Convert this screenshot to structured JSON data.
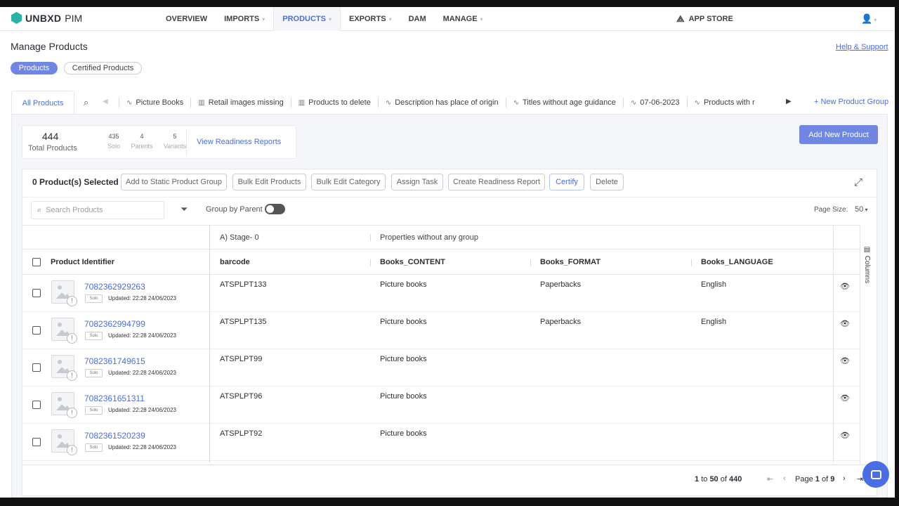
{
  "brand": {
    "name": "UNBXD",
    "product": "PIM"
  },
  "nav": {
    "items": [
      {
        "label": "OVERVIEW",
        "caret": false,
        "active": false
      },
      {
        "label": "IMPORTS",
        "caret": true,
        "active": false
      },
      {
        "label": "PRODUCTS",
        "caret": true,
        "active": true
      },
      {
        "label": "EXPORTS",
        "caret": true,
        "active": false
      },
      {
        "label": "DAM",
        "caret": false,
        "active": false
      },
      {
        "label": "MANAGE",
        "caret": true,
        "active": false
      }
    ],
    "app_store": "APP STORE"
  },
  "header": {
    "title": "Manage Products",
    "help": "Help & Support",
    "pill_products": "Products",
    "pill_certified": "Certified Products"
  },
  "tabs": {
    "all": "All Products",
    "groups": [
      {
        "label": "Picture Books",
        "icon": "pulse-icon"
      },
      {
        "label": "Retail images missing",
        "icon": "bar-icon"
      },
      {
        "label": "Products to delete",
        "icon": "bar-icon"
      },
      {
        "label": "Description has place of origin",
        "icon": "pulse-icon"
      },
      {
        "label": "Titles without age guidance",
        "icon": "pulse-icon"
      },
      {
        "label": "07-06-2023",
        "icon": "pulse-icon"
      },
      {
        "label": "Products with r",
        "icon": "pulse-icon"
      }
    ],
    "new_group": "+ New Product Group"
  },
  "stats": {
    "total": "444",
    "total_label": "Total Products",
    "solo": "435",
    "solo_label": "Solo",
    "parents": "4",
    "parents_label": "Parents",
    "variants": "5",
    "variants_label": "Variants",
    "readiness_link": "View Readiness Reports",
    "add_new": "Add New Product"
  },
  "actions": {
    "selected": "0 Product(s) Selected",
    "buttons": [
      "Add to Static Product Group",
      "Bulk Edit Products",
      "Bulk Edit Category",
      "Assign Task",
      "Create Readiness Report",
      "Certify",
      "Delete"
    ]
  },
  "filters": {
    "search_placeholder": "Search Products",
    "group_by": "Group by Parent",
    "group_by_enabled": false,
    "page_size_label": "Page Size:",
    "page_size": "50"
  },
  "table": {
    "group_headers": [
      "A) Stage- 0",
      "Properties without any group"
    ],
    "columns": [
      "Product Identifier",
      "barcode",
      "Books_CONTENT",
      "Books_FORMAT",
      "Books_LANGUAGE"
    ],
    "rows": [
      {
        "id": "7082362929263",
        "badge": "Solo",
        "updated": "Updated: 22:28 24/06/2023",
        "barcode": "ATSPLPT133",
        "content": "Picture books",
        "format": "Paperbacks",
        "language": "English"
      },
      {
        "id": "7082362994799",
        "badge": "Solo",
        "updated": "Updated: 22:28 24/06/2023",
        "barcode": "ATSPLPT135",
        "content": "Picture books",
        "format": "Paperbacks",
        "language": "English"
      },
      {
        "id": "7082361749615",
        "badge": "Solo",
        "updated": "Updated: 22:28 24/06/2023",
        "barcode": "ATSPLPT99",
        "content": "Picture books",
        "format": "",
        "language": ""
      },
      {
        "id": "7082361651311",
        "badge": "Solo",
        "updated": "Updated: 22:28 24/06/2023",
        "barcode": "ATSPLPT96",
        "content": "Picture books",
        "format": "",
        "language": ""
      },
      {
        "id": "7082361520239",
        "badge": "Solo",
        "updated": "Updated: 22:28 24/06/2023",
        "barcode": "ATSPLPT92",
        "content": "Picture books",
        "format": "",
        "language": ""
      }
    ],
    "columns_side": "Columns"
  },
  "pagination": {
    "from": "1",
    "to_word": "to",
    "to": "50",
    "of_word": "of",
    "total": "440",
    "page_word": "Page",
    "page": "1",
    "page_of": "of",
    "pages": "9"
  },
  "colors": {
    "accent": "#4a6de5",
    "brand": "#27b3a6",
    "button": "#6f87e3"
  }
}
